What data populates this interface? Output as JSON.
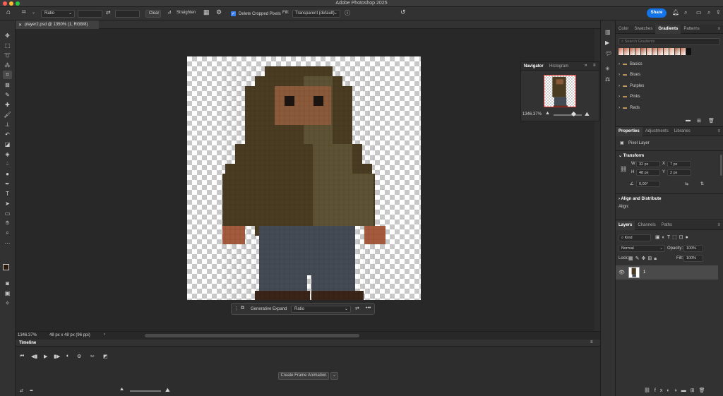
{
  "app": {
    "title": "Adobe Photoshop 2025",
    "colors": {
      "accent": "#1473e6",
      "close": "#ff5f57",
      "minimize": "#febc2e",
      "maximize": "#28c840"
    }
  },
  "options": {
    "ratio": "Ratio",
    "clear": "Clear",
    "straighten": "Straighten",
    "delete_cropped": "Delete Cropped Pixels",
    "fill_label": "Fill:",
    "fill_value": "Transparent (default)",
    "share": "Share"
  },
  "document": {
    "tab": "player2.psd @ 1350% (1, RGB/8)",
    "zoom": "1346.37%",
    "info": "48 px x 48 px (96 ppi)",
    "status_arrow": "›"
  },
  "context_bar": {
    "label": "Generative Expand",
    "ratio": "Ratio"
  },
  "navigator": {
    "tabs": [
      "Navigator",
      "Histogram"
    ],
    "zoom": "1346.37%"
  },
  "timeline": {
    "title": "Timeline",
    "create_button": "Create Frame Animation"
  },
  "gradients": {
    "tabs": [
      "Color",
      "Swatches",
      "Gradients",
      "Patterns"
    ],
    "search_placeholder": "Search Gradients",
    "folders": [
      "Basics",
      "Blues",
      "Purples",
      "Pinks",
      "Reds"
    ]
  },
  "properties": {
    "tabs": [
      "Properties",
      "Adjustments",
      "Libraries"
    ],
    "layer_type": "Pixel Layer",
    "transform_title": "Transform",
    "w_label": "W",
    "w": "32 px",
    "h_label": "H",
    "h": "48 px",
    "x_label": "X",
    "x": "7 px",
    "y_label": "Y",
    "y": "2 px",
    "angle": "0,00°",
    "align_title": "Align and Distribute",
    "align_label": "Align:"
  },
  "layers": {
    "tabs": [
      "Layers",
      "Channels",
      "Paths"
    ],
    "kind": "Kind",
    "blend": "Normal",
    "opacity_label": "Opacity:",
    "opacity": "100%",
    "lock_label": "Lock:",
    "fill_label": "Fill:",
    "fill": "100%",
    "layer_name": "1"
  }
}
